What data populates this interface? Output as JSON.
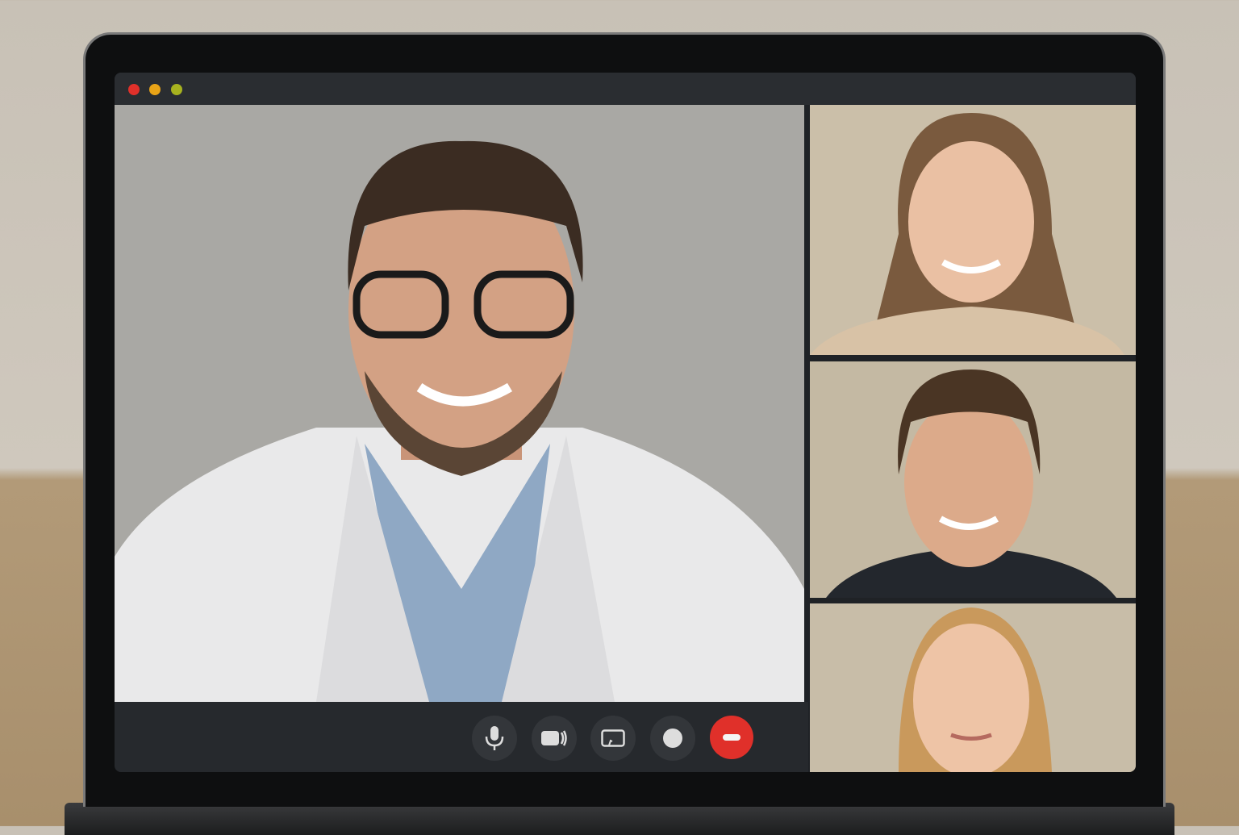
{
  "window": {
    "controls": [
      {
        "name": "close",
        "color": "#e0302a"
      },
      {
        "name": "minimize",
        "color": "#e8a317"
      },
      {
        "name": "maximize",
        "color": "#a7b21f"
      }
    ]
  },
  "main_video": {
    "background": "#a9a8a4"
  },
  "participants": [
    {
      "background": "#cbbfa9"
    },
    {
      "background": "#c4b9a3"
    },
    {
      "background": "#c8bda8"
    }
  ],
  "controls": [
    {
      "icon": "microphone-icon"
    },
    {
      "icon": "camera-icon"
    },
    {
      "icon": "screen-share-icon"
    },
    {
      "icon": "record-icon"
    },
    {
      "icon": "end-call-icon",
      "color": "#e0302a"
    }
  ]
}
